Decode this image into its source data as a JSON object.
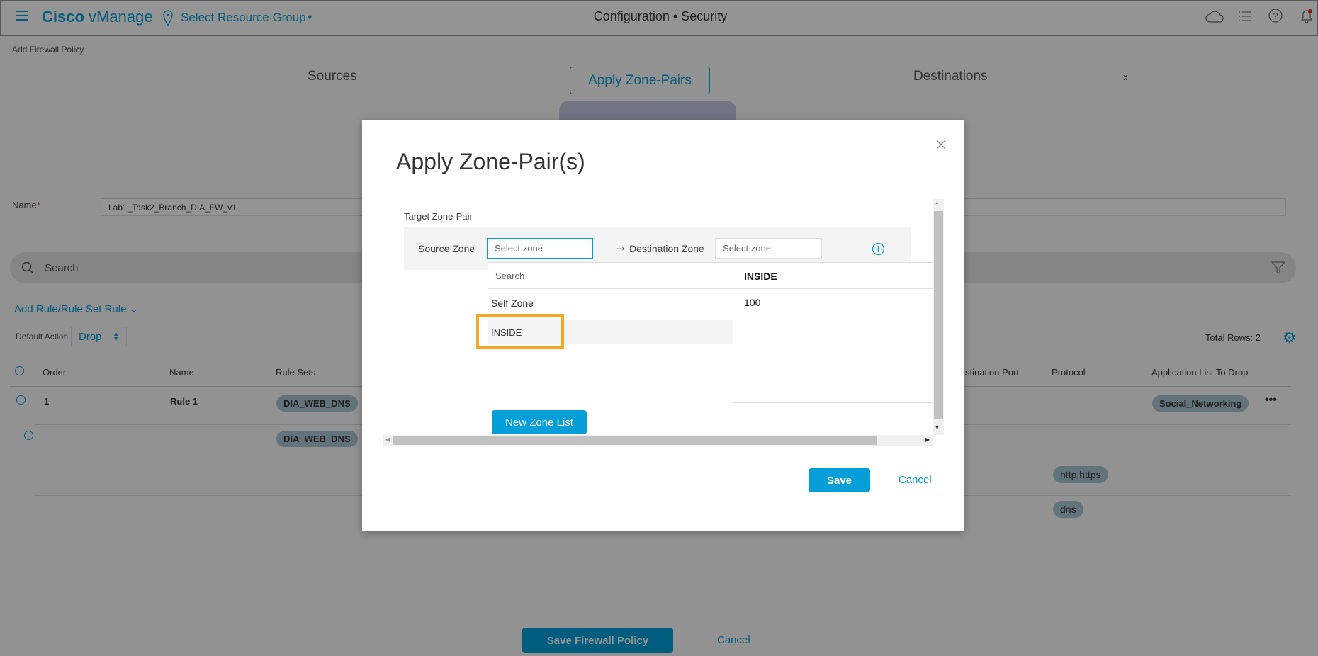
{
  "header": {
    "app_name_bold": "Cisco",
    "app_name": "vManage",
    "resource_group": "Select Resource Group",
    "title_section": "Configuration",
    "title_sep": "•",
    "title_page": "Security"
  },
  "page": {
    "breadcrumb": "Add Firewall Policy",
    "tabs": [
      "Sources",
      "Apply Zone-Pairs",
      "Destinations"
    ],
    "name_label": "Name",
    "name_required": "*",
    "name_value": "Lab1_Task2_Branch_DIA_FW_v1",
    "search_placeholder": "Search",
    "add_rule": "Add Rule/Rule Set Rule",
    "default_action_label": "Default Action",
    "default_action_value": "Drop",
    "total_rows": "Total Rows: 2",
    "columns": [
      "Order",
      "Name",
      "Rule Sets",
      "stination Port",
      "Protocol",
      "Application List To Drop"
    ],
    "rows": [
      {
        "order": "1",
        "name": "Rule 1",
        "rule_set": "DIA_WEB_DNS",
        "app_list": "Social_Networking"
      },
      {
        "rule_set": "DIA_WEB_DNS"
      },
      {
        "protocol": "http,https"
      },
      {
        "protocol": "dns"
      }
    ],
    "save_policy": "Save Firewall Policy",
    "cancel": "Cancel"
  },
  "modal": {
    "title": "Apply Zone-Pair(s)",
    "target_label": "Target Zone-Pair",
    "source_label": "Source Zone",
    "source_placeholder": "Select zone",
    "dest_label": "Destination Zone",
    "dest_placeholder": "Select zone",
    "dropdown": {
      "search_placeholder": "Search",
      "options": [
        "Self Zone",
        "INSIDE"
      ],
      "highlighted": "INSIDE",
      "new_zone_list": "New Zone List",
      "preview_title": "INSIDE",
      "preview_value": "100"
    },
    "save": "Save",
    "cancel": "Cancel"
  },
  "colors": {
    "accent": "#049fd9",
    "highlight": "#f5a623",
    "notification": "#e2231a"
  }
}
